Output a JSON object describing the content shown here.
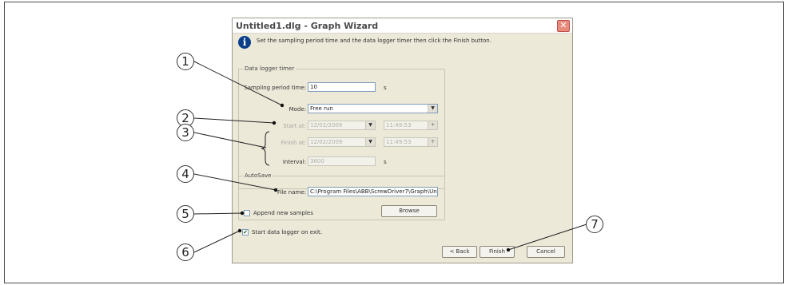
{
  "dialog": {
    "title": "Untitled1.dlg - Graph Wizard",
    "close_glyph": "✕",
    "instruction": "Set the sampling period time and the data logger timer then click the Finish button."
  },
  "data_logger_timer": {
    "legend": "Data logger timer",
    "sampling_label": "Sampling period time:",
    "sampling_value": "10",
    "sampling_unit": "s",
    "mode_label": "Mode:",
    "mode_value": "Free run",
    "start_label": "Start at:",
    "start_date": "12/02/2009",
    "start_time": "11:49:53",
    "finish_label": "Finish at:",
    "finish_date": "12/02/2009",
    "finish_time": "11:49:53",
    "interval_label": "Interval:",
    "interval_value": "3600",
    "interval_unit": "s"
  },
  "autosave": {
    "legend": "AutoSave",
    "file_label": "File name:",
    "file_value": "C:\\Program Files\\ABB\\ScrewDriver7\\Graph\\Un",
    "append_label": "Append new samples",
    "browse_label": "Browse"
  },
  "start_logger": {
    "label": "Start data logger on exit.",
    "checked_glyph": "✔"
  },
  "buttons": {
    "back": "< Back",
    "finish": "Finish",
    "cancel": "Cancel"
  },
  "callouts": [
    "1",
    "2",
    "3",
    "4",
    "5",
    "6",
    "7"
  ]
}
